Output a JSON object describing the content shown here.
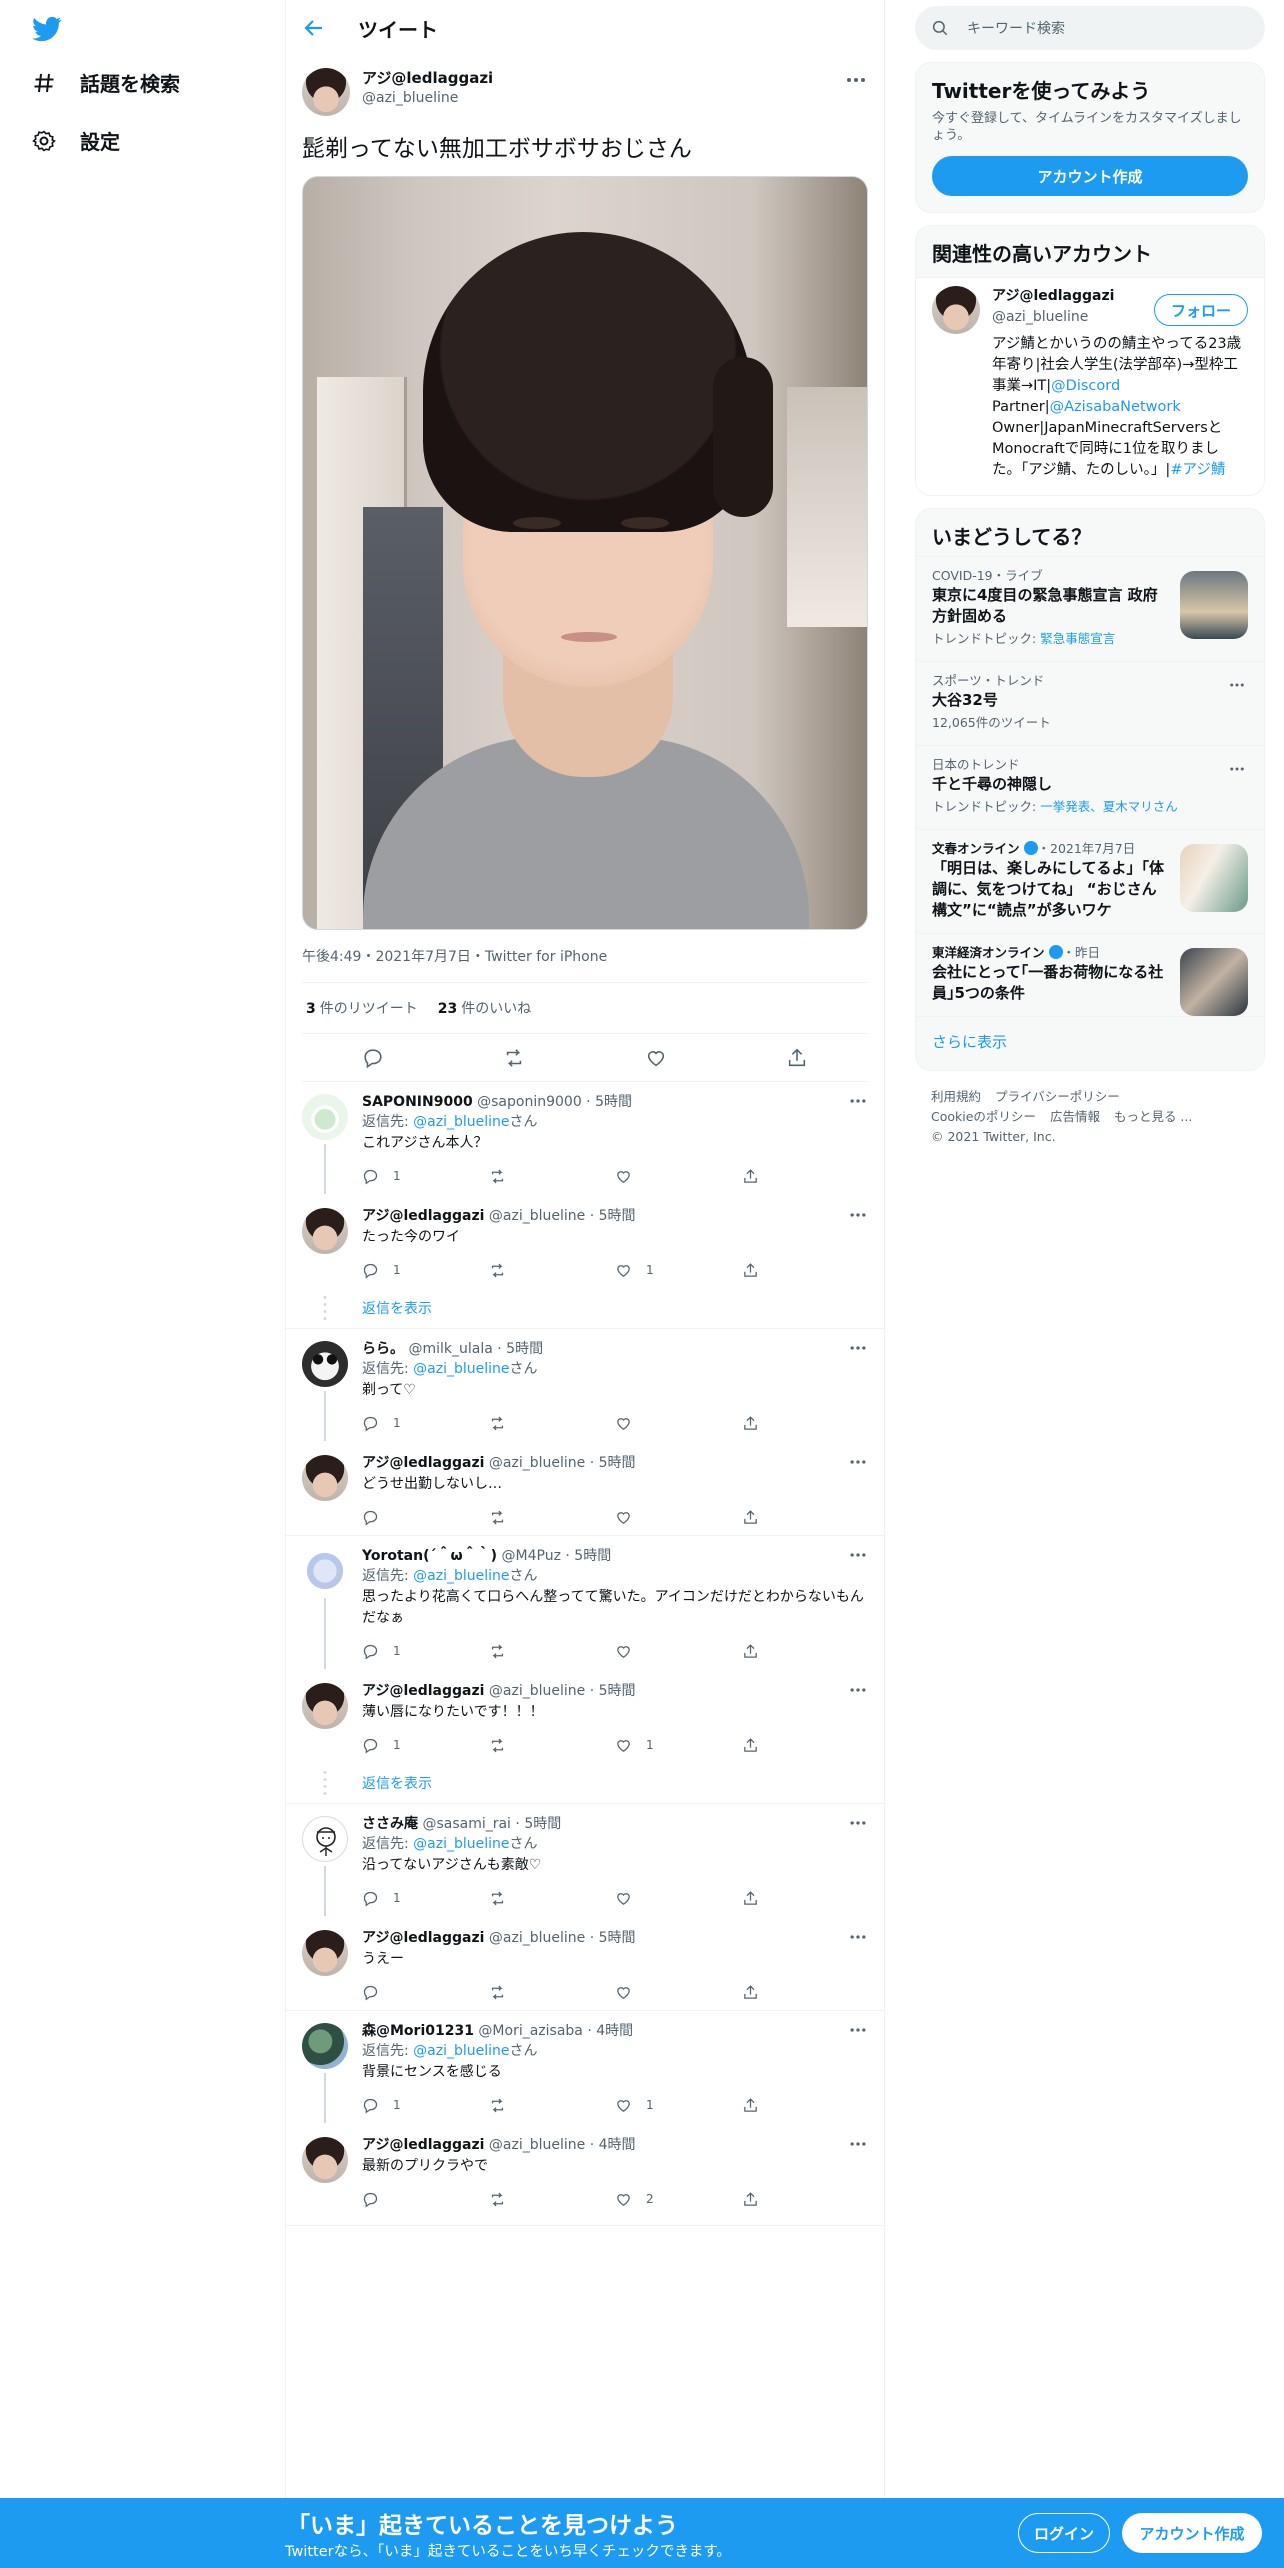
{
  "colors": {
    "accent": "#1d9bf0",
    "text": "#0f1419",
    "muted": "#536471",
    "border": "#eff3f4"
  },
  "nav": {
    "explore": "話題を検索",
    "settings": "設定",
    "explore_icon": "hash-icon",
    "settings_icon": "gear-icon"
  },
  "header": {
    "title": "ツイート"
  },
  "tweet": {
    "name": "アジ@ledlaggazi",
    "handle": "@azi_blueline",
    "text": "髭剃ってない無加工ボサボサおじさん",
    "meta": "午後4:49・2021年7月7日・Twitter for iPhone",
    "retweets": "3",
    "retweets_label": "件のリツイート",
    "likes": "23",
    "likes_label": "件のいいね"
  },
  "threads": [
    {
      "replies": [
        {
          "name": "SAPONIN9000",
          "handle": "@saponin9000",
          "time": "5時間",
          "reply_to_prefix": "返信先: ",
          "reply_to": "@azi_blueline",
          "reply_to_suffix": "さん",
          "text": "これアジさん本人？",
          "reply_count": "1",
          "like_count": ""
        },
        {
          "name": "アジ@ledlaggazi",
          "handle": "@azi_blueline",
          "time": "5時間",
          "text": "たった今のワイ",
          "reply_count": "1",
          "like_count": "1"
        }
      ],
      "show_replies": "返信を表示"
    },
    {
      "replies": [
        {
          "name": "らら。",
          "handle": "@milk_ulala",
          "time": "5時間",
          "reply_to_prefix": "返信先: ",
          "reply_to": "@azi_blueline",
          "reply_to_suffix": "さん",
          "text": "剃って♡",
          "reply_count": "1",
          "like_count": ""
        },
        {
          "name": "アジ@ledlaggazi",
          "handle": "@azi_blueline",
          "time": "5時間",
          "text": "どうせ出勤しないし…",
          "reply_count": "",
          "like_count": ""
        }
      ]
    },
    {
      "replies": [
        {
          "name": "Yorotan(´＾ω＾｀)",
          "handle": "@M4Puz",
          "time": "5時間",
          "reply_to_prefix": "返信先: ",
          "reply_to": "@azi_blueline",
          "reply_to_suffix": "さん",
          "text": "思ったより花高くて口らへん整ってて驚いた。アイコンだけだとわからないもんだなぁ",
          "reply_count": "1",
          "like_count": ""
        },
        {
          "name": "アジ@ledlaggazi",
          "handle": "@azi_blueline",
          "time": "5時間",
          "text": "薄い唇になりたいです！！！",
          "reply_count": "1",
          "like_count": "1"
        }
      ],
      "show_replies": "返信を表示"
    },
    {
      "replies": [
        {
          "name": "ささみ庵",
          "handle": "@sasami_rai",
          "time": "5時間",
          "reply_to_prefix": "返信先: ",
          "reply_to": "@azi_blueline",
          "reply_to_suffix": "さん",
          "text": "沿ってないアジさんも素敵♡",
          "reply_count": "1",
          "like_count": ""
        },
        {
          "name": "アジ@ledlaggazi",
          "handle": "@azi_blueline",
          "time": "5時間",
          "text": "うえー",
          "reply_count": "",
          "like_count": ""
        }
      ]
    },
    {
      "replies": [
        {
          "name": "森@Mori01231",
          "handle": "@Mori_azisaba",
          "time": "4時間",
          "reply_to_prefix": "返信先: ",
          "reply_to": "@azi_blueline",
          "reply_to_suffix": "さん",
          "text": "背景にセンスを感じる",
          "reply_count": "1",
          "like_count": "1"
        },
        {
          "name": "アジ@ledlaggazi",
          "handle": "@azi_blueline",
          "time": "4時間",
          "text": "最新のプリクラやで",
          "reply_count": "",
          "like_count": "2"
        }
      ]
    }
  ],
  "search": {
    "placeholder": "キーワード検索"
  },
  "join": {
    "title": "Twitterを使ってみよう",
    "subtitle": "今すぐ登録して、タイムラインをカスタマイズしましょう。",
    "button": "アカウント作成"
  },
  "related": {
    "title": "関連性の高いアカウント",
    "name": "アジ@ledlaggazi",
    "handle": "@azi_blueline",
    "follow": "フォロー",
    "bio_1": "アジ鯖とかいうのの鯖主やってる23歳年寄り|社会人学生(法学部卒)→型枠工事業→IT|",
    "bio_link1": "@Discord",
    "bio_2": " Partner|",
    "bio_link2": "@AzisabaNetwork",
    "bio_3": " Owner|JapanMinecraftServersとMonocraftで同時に1位を取りました。「アジ鯖、たのしい。」|",
    "bio_link3": "#アジ鯖"
  },
  "trends": {
    "title": "いまどうしてる？",
    "items": [
      {
        "context": "COVID-19・ライブ",
        "title": "東京に4度目の緊急事態宣言 政府方針固める",
        "sub_prefix": "トレンドトピック: ",
        "sub_link": "緊急事態宣言"
      },
      {
        "context": "スポーツ・トレンド",
        "title": "大谷32号",
        "sub": "12,065件のツイート"
      },
      {
        "context": "日本のトレンド",
        "title": "千と千尋の神隠し",
        "sub_prefix": "トレンドトピック: ",
        "sub_link": "一挙発表、夏木マリさん"
      },
      {
        "context_source": "文春オンライン",
        "context_time": "・2021年7月7日",
        "title": "「明日は、楽しみにしてるよ」「体調に、気をつけてね」 “おじさん構文”に“読点”が多いワケ"
      },
      {
        "context_source": "東洋経済オンライン",
        "context_time": "・昨日",
        "title": "会社にとって｢一番お荷物になる社員｣5つの条件"
      }
    ],
    "show_more": "さらに表示"
  },
  "footer": {
    "terms": "利用規約",
    "privacy": "プライバシーポリシー",
    "cookies": "Cookieのポリシー",
    "ads": "広告情報",
    "more": "もっと見る ...",
    "copyright": "© 2021 Twitter, Inc."
  },
  "bottom": {
    "headline": "「いま」起きていることを見つけよう",
    "sub": "Twitterなら、「いま」起きていることをいち早くチェックできます。",
    "login": "ログイン",
    "signup": "アカウント作成"
  }
}
